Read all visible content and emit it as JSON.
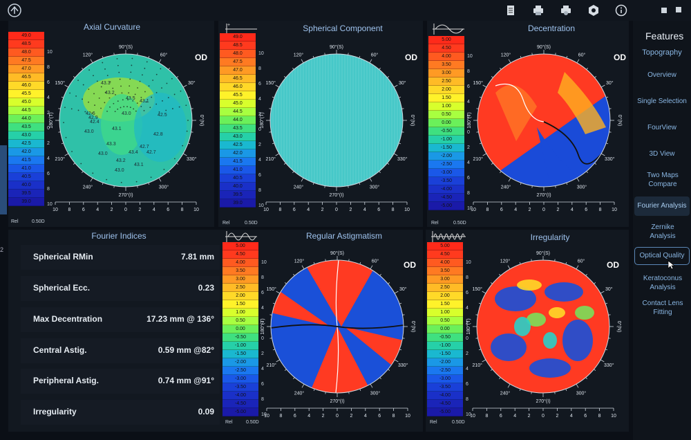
{
  "toolbar": {
    "icons": [
      "logo-icon",
      "report-icon",
      "print-icon",
      "print-preview-icon",
      "settings-icon",
      "info-icon"
    ]
  },
  "scales": {
    "curvature": [
      "49.0",
      "48.5",
      "48.0",
      "47.5",
      "47.0",
      "46.5",
      "46.0",
      "45.5",
      "45.0",
      "44.5",
      "44.0",
      "43.5",
      "43.0",
      "42.5",
      "42.0",
      "41.5",
      "41.0",
      "40.5",
      "40.0",
      "39.5",
      "39.0"
    ],
    "diopter": [
      "5.00",
      "4.50",
      "4.00",
      "3.50",
      "3.00",
      "2.50",
      "2.00",
      "1.50",
      "1.00",
      "0.50",
      "0.00",
      "-0.50",
      "-1.00",
      "-1.50",
      "-2.00",
      "-2.50",
      "-3.00",
      "-3.50",
      "-4.00",
      "-4.50",
      "-5.00"
    ],
    "colors": [
      "#ff2a1a",
      "#ff3a1e",
      "#ff5a20",
      "#ff7a22",
      "#ff9a24",
      "#ffbb26",
      "#ffd928",
      "#fff22a",
      "#d8ff2c",
      "#a8ff40",
      "#6bf05a",
      "#3fe080",
      "#26d0a8",
      "#1ab8d0",
      "#1a98e6",
      "#1a78f0",
      "#1a58e8",
      "#1a40d8",
      "#1a30c8",
      "#1a24b8",
      "#1a1aa8"
    ],
    "rel_label": "Rel",
    "step_label": "0.50D"
  },
  "maps": {
    "axial": {
      "title": "Axial Curvature",
      "eye": "OD",
      "values": [
        "43.3",
        "43.2",
        "42.6",
        "43.5",
        "43.1",
        "42.5",
        "42.9",
        "43.0",
        "42.4",
        "42.8",
        "43.0",
        "43.1",
        "43.3",
        "42.7",
        "43.0",
        "43.4",
        "42.7",
        "43.2",
        "43.1",
        "43.0"
      ]
    },
    "spherical": {
      "title": "Spherical Component",
      "eye": "OD"
    },
    "decentration": {
      "title": "Decentration",
      "eye": "OD"
    },
    "regular": {
      "title": "Regular Astigmatism",
      "eye": "OD"
    },
    "irregularity": {
      "title": "Irregularity",
      "eye": "OD"
    }
  },
  "axis": {
    "top": "90°(S)",
    "bottom": "270°(I)",
    "left": "180°(T)",
    "right": "0°(N)",
    "angles": [
      "120°",
      "60°",
      "150°",
      "30°",
      "210°",
      "330°",
      "240°",
      "300°"
    ],
    "ticks": [
      "10",
      "8",
      "6",
      "4",
      "2",
      "0",
      "2",
      "4",
      "6",
      "8",
      "10"
    ]
  },
  "fourier": {
    "title": "Fourier Indices",
    "rows": [
      {
        "label": "Spherical RMin",
        "value": "7.81 mm"
      },
      {
        "label": "Spherical Ecc.",
        "value": "0.23"
      },
      {
        "label": "Max Decentration",
        "value": "17.23 mm @ 136°"
      },
      {
        "label": "Central Astig.",
        "value": "0.59 mm @82°"
      },
      {
        "label": "Peripheral Astig.",
        "value": "0.74 mm @91°"
      },
      {
        "label": "Irregularity",
        "value": "0.09"
      }
    ]
  },
  "sidebar": {
    "title": "Features",
    "items": [
      {
        "label": "Topography"
      },
      {
        "label": "Overview"
      },
      {
        "label": "Single Selection"
      },
      {
        "label": "FourView"
      },
      {
        "label": "3D View"
      },
      {
        "label": "Two Maps Compare"
      },
      {
        "label": "Fourier Analysis"
      },
      {
        "label": "Zernike Analysis"
      },
      {
        "label": "Optical Quality"
      },
      {
        "label": "Keratoconus Analysis"
      },
      {
        "label": "Contact Lens Fitting"
      }
    ]
  },
  "left_edge_label": "2"
}
